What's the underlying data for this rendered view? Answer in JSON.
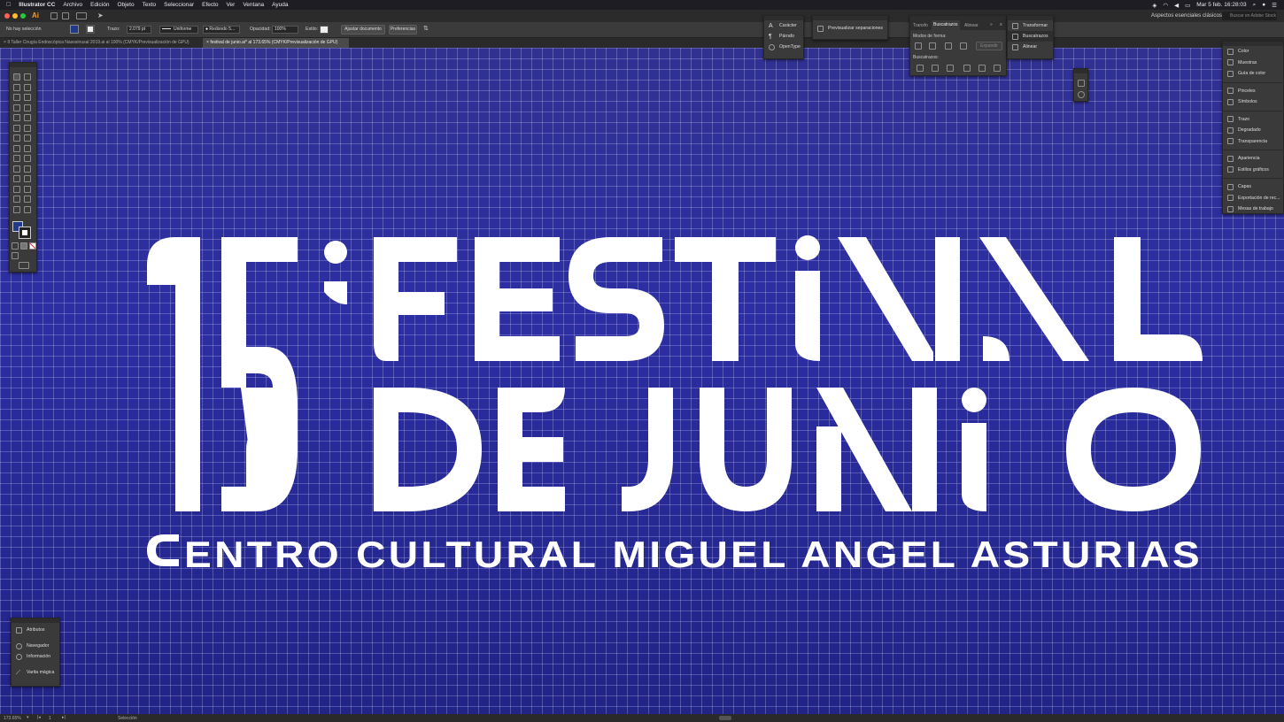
{
  "menubar": {
    "app_name": "Illustrator CC",
    "items": [
      "Archivo",
      "Edición",
      "Objeto",
      "Texto",
      "Seleccionar",
      "Efecto",
      "Ver",
      "Ventana",
      "Ayuda"
    ],
    "clock": "Mar 5 feb.  16:28:03"
  },
  "appbar": {
    "logo": "Ai",
    "workspace": "Aspectos esenciales clásicos",
    "search_placeholder": "Buscar en Adobe Stock"
  },
  "controlbar": {
    "selection": "No hay selección",
    "stroke_label": "Trazo:",
    "stroke_value": "2.079 pt",
    "profile": "Uniforme",
    "brush": "Redondo 5...",
    "opacity_label": "Opacidad:",
    "opacity_value": "100%",
    "style_label": "Estilo:",
    "adjust_doc": "Ajustar documento",
    "preferences": "Preferencias"
  },
  "tabs": [
    "II Taller Cirugía Endoscópica Nasosinusal 2019.ai al 100% (CMYK/Previsualización de GPU)",
    "festival de junio.ai* al 173.65% (CMYK/Previsualización de GPU)"
  ],
  "panels": {
    "char": [
      "Carácter",
      "Párrafo",
      "OpenType"
    ],
    "preview": "Previsualizar separaciones",
    "pathfinder": {
      "tabs": [
        "Transfo",
        "Buscatrazos",
        "Alinear"
      ],
      "shape_modes": "Modos de forma:",
      "expand": "Expandir",
      "pathfinders": "Buscatrazos:"
    },
    "transform_list": [
      "Transformar",
      "Buscatrazos",
      "Alinear"
    ],
    "right_dock": [
      [
        "Color",
        "Muestras",
        "Guía de color"
      ],
      [
        "Pinceles",
        "Símbolos"
      ],
      [
        "Trazo",
        "Degradado",
        "Transparencia"
      ],
      [
        "Apariencia",
        "Estilos gráficos"
      ],
      [
        "Capas",
        "Exportación de rec...",
        "Mesas de trabajo"
      ]
    ],
    "bottom_left": [
      "Atributos",
      "Navegador",
      "Información",
      "Varita mágica"
    ]
  },
  "status": {
    "zoom": "173.65%",
    "page": "1",
    "tool": "Selección"
  },
  "colors": {
    "accent_orange": "#f29a2e",
    "canvas_blue": "#2c2ea3",
    "artwork_white": "#ffffff"
  }
}
